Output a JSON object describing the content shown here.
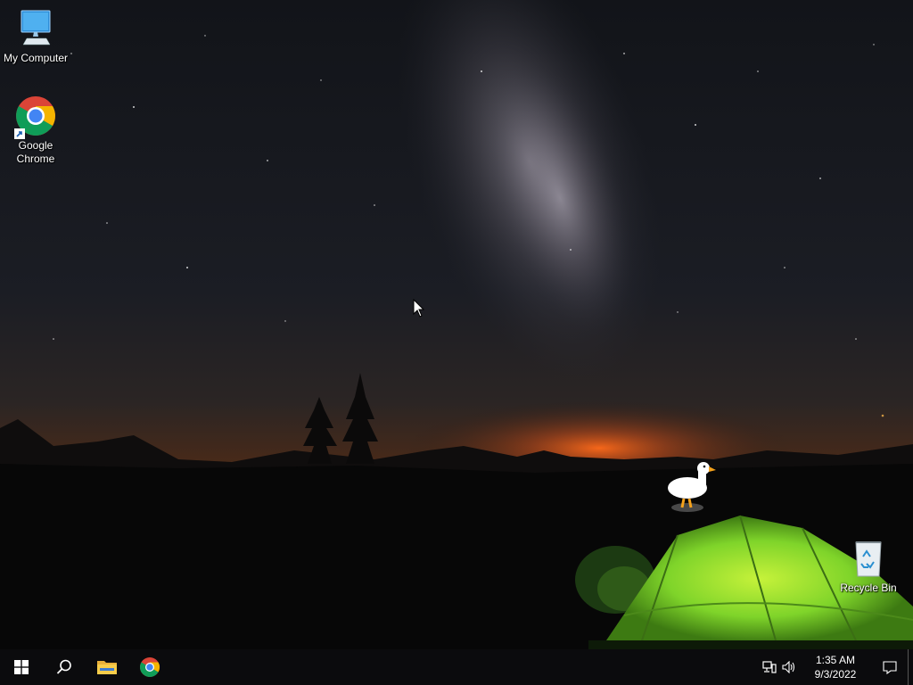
{
  "desktop": {
    "icons": [
      {
        "label": "My Computer",
        "icon": "computer-icon"
      },
      {
        "label": "Google Chrome",
        "icon": "chrome-icon"
      },
      {
        "label": "Recycle Bin",
        "icon": "recycle-bin-icon"
      }
    ]
  },
  "taskbar": {
    "buttons": [
      {
        "name": "start",
        "icon": "windows-logo-icon"
      },
      {
        "name": "search",
        "icon": "search-icon"
      },
      {
        "name": "file-explorer",
        "icon": "folder-icon"
      },
      {
        "name": "chrome",
        "icon": "chrome-icon"
      }
    ],
    "tray": {
      "time": "1:35 AM",
      "date": "9/3/2022"
    }
  },
  "colors": {
    "taskbar": "#0b0b0d",
    "tent": "#7fd42a",
    "horizon_glow": "#e0641c"
  }
}
